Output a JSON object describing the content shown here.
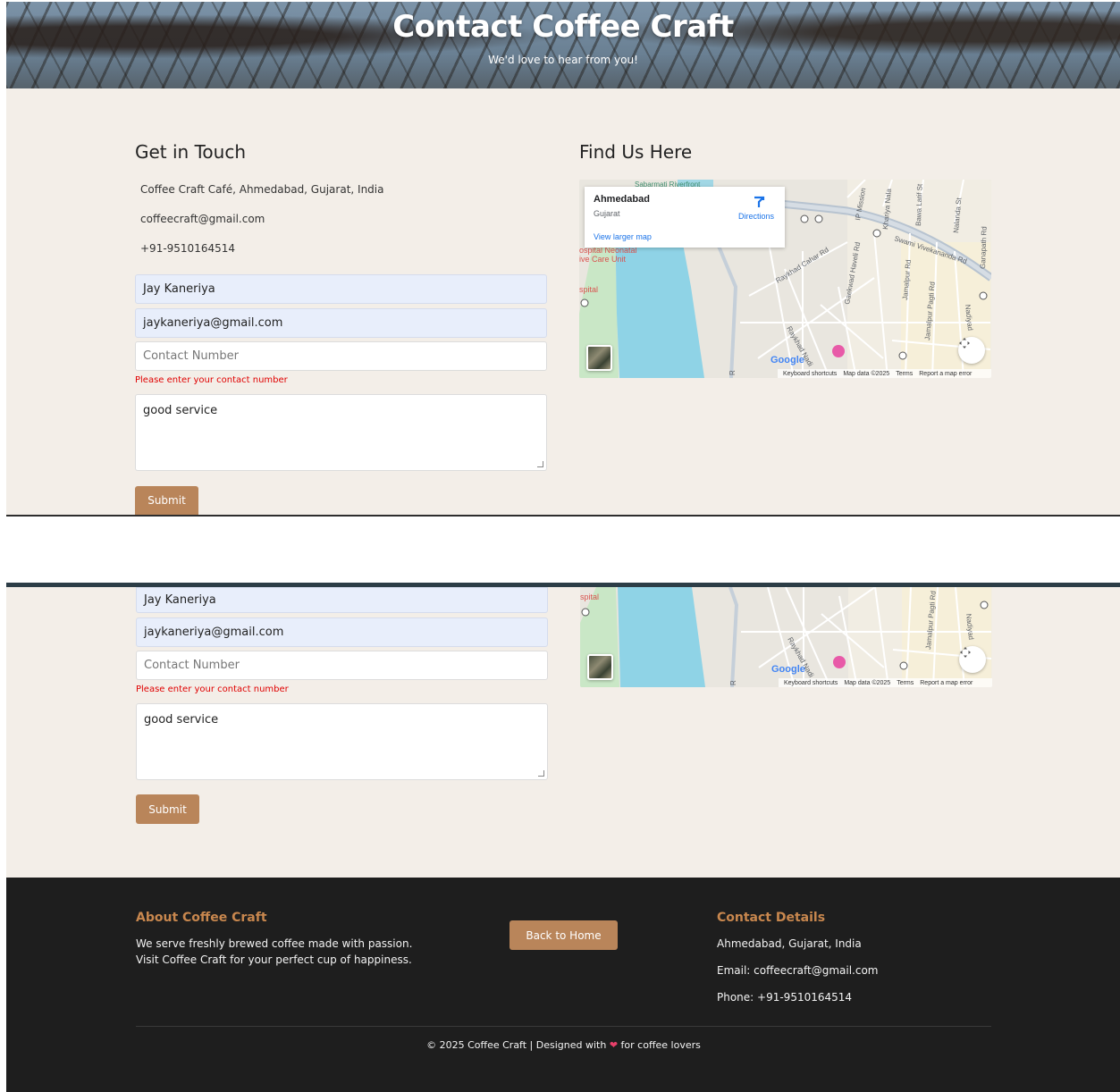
{
  "hero": {
    "title": "Contact Coffee Craft",
    "subtitle": "We'd love to hear from you!"
  },
  "contact": {
    "heading": "Get in Touch",
    "address": "Coffee Craft Café, Ahmedabad, Gujarat, India",
    "email": "coffeecraft@gmail.com",
    "phone": "+91-9510164514"
  },
  "form": {
    "name_value": "Jay Kaneriya",
    "email_value": "jaykaneriya@gmail.com",
    "contact_placeholder": "Contact Number",
    "contact_error": "Please enter your contact number",
    "message_value": "good service",
    "submit_label": "Submit"
  },
  "map": {
    "heading": "Find Us Here",
    "place_name": "Ahmedabad",
    "place_region": "Gujarat",
    "directions_label": "Directions",
    "larger_map_link": "View larger map",
    "labels": {
      "riverfront": "Sabarmati Riverfront",
      "hospital": "ospital Neonatal",
      "care_unit": "ive Care Unit",
      "hospital2": "spital",
      "cahar_rd": "Raykhad Cahar Rd",
      "gaekwad": "Gaekwad Haveli Rd",
      "jamalpur": "Jamalpur Rd",
      "jamalpur_pagti": "Jamalpur Pagti Rd",
      "swami": "Swami Vivekananda Rd",
      "ip_mission": "IP Mission",
      "khariya": "Khariya Nala",
      "bawa": "Bawa Latif St",
      "nalanda": "Nalanda St",
      "ganapathi": "Ganapath Rd",
      "nadiyad": "Nadiyad",
      "raykhad_nadi": "Raykhad Nadi",
      "riverside": "R"
    },
    "google_logo": "Google",
    "attribution": {
      "shortcuts": "Keyboard shortcuts",
      "map_data": "Map data ©2025",
      "terms": "Terms",
      "report": "Report a map error"
    }
  },
  "footer": {
    "about_heading": "About Coffee Craft",
    "about_line1": "We serve freshly brewed coffee made with passion.",
    "about_line2": "Visit Coffee Craft for your perfect cup of happiness.",
    "back_home_label": "Back to Home",
    "contact_heading": "Contact Details",
    "contact_address": "Ahmedabad, Gujarat, India",
    "contact_email": "Email: coffeecraft@gmail.com",
    "contact_phone": "Phone: +91-9510164514",
    "copyright_left": "© 2025 Coffee Craft | Designed with",
    "copyright_right": "for coffee lovers"
  },
  "colors": {
    "accent": "#b9855a",
    "footer_heading": "#c8874e",
    "cream": "#f3eee8",
    "footer_bg": "#1e1e1e",
    "error": "#e00000",
    "river": "#8fd3e6"
  }
}
